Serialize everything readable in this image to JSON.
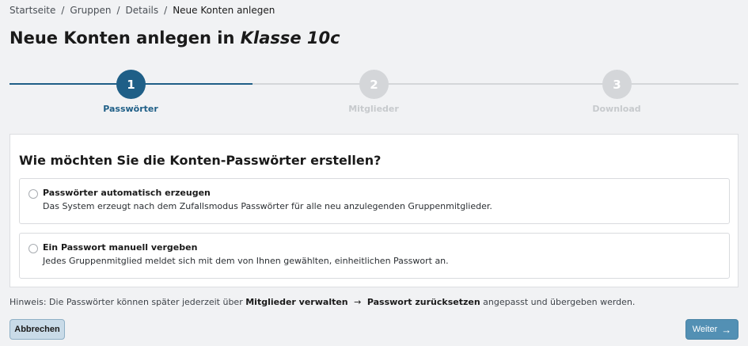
{
  "breadcrumb": {
    "items": [
      "Startseite",
      "Gruppen",
      "Details",
      "Neue Konten anlegen"
    ],
    "separator": "/"
  },
  "title": {
    "prefix": "Neue Konten anlegen in",
    "class_name": "Klasse 10c"
  },
  "stepper": {
    "steps": [
      {
        "number": "1",
        "label": "Passwörter",
        "state": "active"
      },
      {
        "number": "2",
        "label": "Mitglieder",
        "state": "inactive"
      },
      {
        "number": "3",
        "label": "Download",
        "state": "inactive"
      }
    ]
  },
  "card": {
    "heading": "Wie möchten Sie die Konten-Passwörter erstellen?",
    "options": [
      {
        "title": "Passwörter automatisch erzeugen",
        "description": "Das System erzeugt nach dem Zufallsmodus Passwörter für alle neu anzulegenden Gruppenmitglieder.",
        "selected": false
      },
      {
        "title": "Ein Passwort manuell vergeben",
        "description": "Jedes Gruppenmitglied meldet sich mit dem von Ihnen gewählten, einheitlichen Passwort an.",
        "selected": false
      }
    ]
  },
  "hint": {
    "prefix": "Hinweis: Die Passwörter können später jederzeit über",
    "link1": "Mitglieder verwalten",
    "arrow": "→",
    "link2": "Passwort zurücksetzen",
    "suffix": "angepasst und übergeben werden."
  },
  "buttons": {
    "cancel_label": "Abbrechen",
    "next_label": "Weiter",
    "next_icon": "arrow-right-icon"
  },
  "colors": {
    "accent": "#1f5f87",
    "inactive": "#d4d6d9",
    "next_button": "#5390b4",
    "cancel_button": "#c9dbe8"
  }
}
